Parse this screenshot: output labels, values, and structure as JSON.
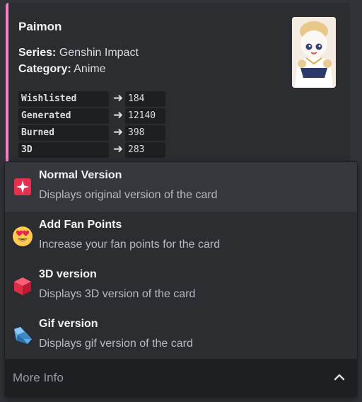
{
  "embed": {
    "accent_color": "#f47fc4",
    "title": "Paimon",
    "series_label": "Series:",
    "series_value": "Genshin Impact",
    "category_label": "Category:",
    "category_value": "Anime",
    "stats": [
      {
        "label": "Wishlisted",
        "value": "184"
      },
      {
        "label": "Generated",
        "value": "12140"
      },
      {
        "label": "Burned",
        "value": "398"
      },
      {
        "label": "3D",
        "value": "283"
      }
    ],
    "arrow_icon": "right-arrow-icon",
    "thumbnail_icon": "character-card-image"
  },
  "select_menu": {
    "placeholder": "More Info",
    "options": [
      {
        "label": "Normal Version",
        "description": "Displays original version of the card",
        "icon": "sparkle-icon",
        "highlighted": true
      },
      {
        "label": "Add Fan Points",
        "description": "Increase your fan points for the card",
        "icon": "heart-eyes-icon",
        "highlighted": false
      },
      {
        "label": "3D version",
        "description": "Displays 3D version of the card",
        "icon": "cube-icon",
        "highlighted": false
      },
      {
        "label": "Gif version",
        "description": "Displays gif version of the card",
        "icon": "crystal-icon",
        "highlighted": false
      }
    ],
    "chevron_icon": "chevron-up-icon"
  }
}
